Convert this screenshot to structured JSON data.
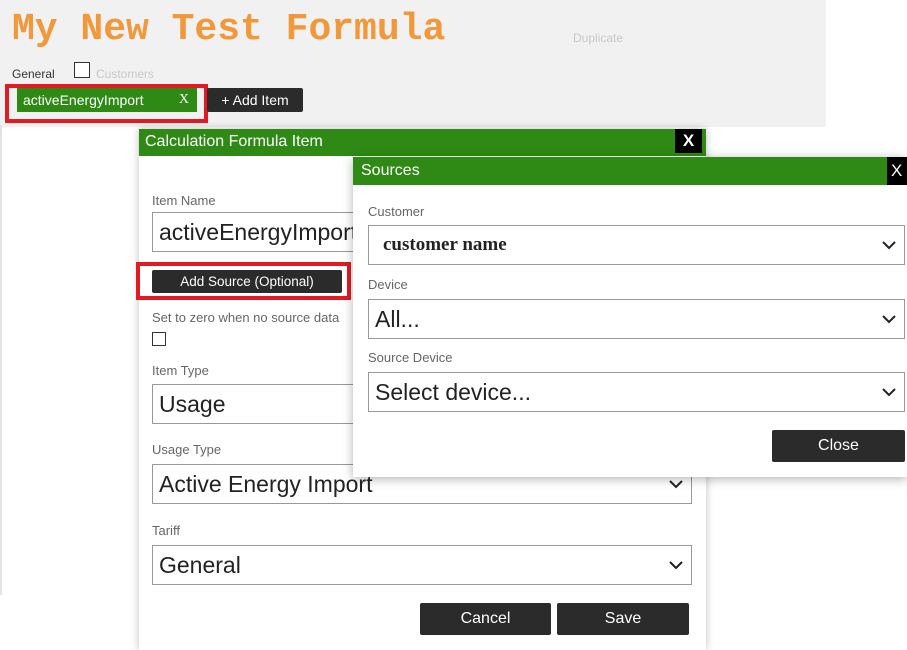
{
  "page": {
    "title": "My New Test Formula",
    "duplicate_label": "Duplicate",
    "tabs": [
      {
        "label": "General"
      },
      {
        "label": "Customers"
      }
    ],
    "item_chip": {
      "label": "activeEnergyImport",
      "close": "X"
    },
    "add_item_label": "+ Add Item"
  },
  "calc_dialog": {
    "title": "Calculation Formula Item",
    "close": "X",
    "item_name_label": "Item Name",
    "item_name_value": "activeEnergyImport",
    "add_source_label": "Add Source (Optional)",
    "zero_label": "Set to zero when no source data",
    "item_type_label": "Item Type",
    "item_type_value": "Usage",
    "usage_type_label": "Usage Type",
    "usage_type_value": "Active Energy Import",
    "tariff_label": "Tariff",
    "tariff_value": "General",
    "cancel_label": "Cancel",
    "save_label": "Save"
  },
  "sources_dialog": {
    "title": "Sources",
    "close": "X",
    "customer_label": "Customer",
    "customer_value": "customer name",
    "device_label": "Device",
    "device_value": "All...",
    "source_device_label": "Source Device",
    "source_device_value": "Select device...",
    "close_button_label": "Close"
  },
  "colors": {
    "title_orange": "#f0983a",
    "header_green": "#2e8a14",
    "highlight_red": "#e21a23",
    "button_dark": "#2b2b2b"
  }
}
